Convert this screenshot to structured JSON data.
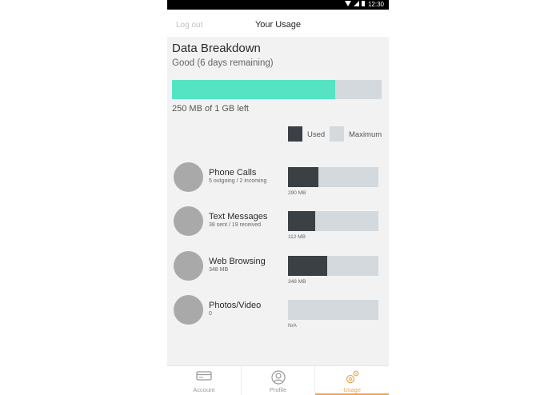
{
  "status_bar": {
    "time": "12:30"
  },
  "header": {
    "logout": "Log out",
    "title": "Your Usage"
  },
  "breakdown": {
    "title": "Data Breakdown",
    "status": "Good (6 days remaining)",
    "progress_fraction": 0.78,
    "remaining_text": "250 MB of 1 GB left"
  },
  "legend": {
    "used": "Used",
    "maximum": "Maximum"
  },
  "categories": [
    {
      "name": "Phone Calls",
      "detail": "5 outgoing / 2 incoming",
      "usage": "290 MB",
      "fraction": 0.34
    },
    {
      "name": "Text Messages",
      "detail": "38 sent / 19 received",
      "usage": "112 MB",
      "fraction": 0.3
    },
    {
      "name": "Web Browsing",
      "detail": "348 MB",
      "usage": "348 MB",
      "fraction": 0.43
    },
    {
      "name": "Photos/Video",
      "detail": "0",
      "usage": "N/A",
      "fraction": 0
    }
  ],
  "tabs": [
    {
      "label": "Account",
      "icon": "card-icon",
      "active": false
    },
    {
      "label": "Profile",
      "icon": "user-icon",
      "active": false
    },
    {
      "label": "Usage",
      "icon": "gears-icon",
      "active": true
    }
  ],
  "colors": {
    "accent": "#55e3c4",
    "used": "#3b4045",
    "track": "#d3d9dc",
    "tab_active": "#f4a44e"
  }
}
